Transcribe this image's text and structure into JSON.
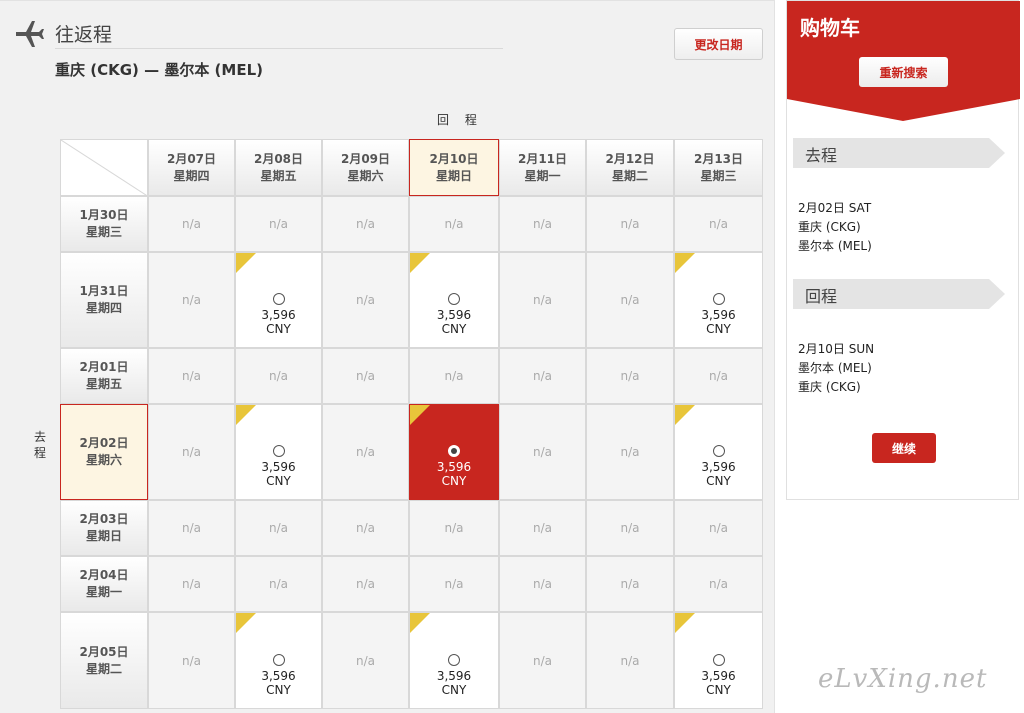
{
  "header": {
    "title": "往返程",
    "route": "重庆 (CKG) — 墨尔本 (MEL)",
    "change_date_label": "更改日期",
    "icon": "plane-icon"
  },
  "grid": {
    "return_label": "回 程",
    "depart_label": "去 程",
    "na": "n/a",
    "return_dates": [
      {
        "date": "2月07日",
        "weekday": "星期四",
        "highlight": false
      },
      {
        "date": "2月08日",
        "weekday": "星期五",
        "highlight": false
      },
      {
        "date": "2月09日",
        "weekday": "星期六",
        "highlight": false
      },
      {
        "date": "2月10日",
        "weekday": "星期日",
        "highlight": true
      },
      {
        "date": "2月11日",
        "weekday": "星期一",
        "highlight": false
      },
      {
        "date": "2月12日",
        "weekday": "星期二",
        "highlight": false
      },
      {
        "date": "2月13日",
        "weekday": "星期三",
        "highlight": false
      }
    ],
    "rows": [
      {
        "date": "1月30日",
        "weekday": "星期三",
        "highlight": false,
        "cells": [
          null,
          null,
          null,
          null,
          null,
          null,
          null
        ]
      },
      {
        "date": "1月31日",
        "weekday": "星期四",
        "highlight": false,
        "cells": [
          null,
          {
            "price": "3,596",
            "currency": "CNY"
          },
          null,
          {
            "price": "3,596",
            "currency": "CNY"
          },
          null,
          null,
          {
            "price": "3,596",
            "currency": "CNY"
          }
        ]
      },
      {
        "date": "2月01日",
        "weekday": "星期五",
        "highlight": false,
        "cells": [
          null,
          null,
          null,
          null,
          null,
          null,
          null
        ]
      },
      {
        "date": "2月02日",
        "weekday": "星期六",
        "highlight": true,
        "cells": [
          null,
          {
            "price": "3,596",
            "currency": "CNY"
          },
          null,
          {
            "price": "3,596",
            "currency": "CNY",
            "selected": true
          },
          null,
          null,
          {
            "price": "3,596",
            "currency": "CNY"
          }
        ]
      },
      {
        "date": "2月03日",
        "weekday": "星期日",
        "highlight": false,
        "cells": [
          null,
          null,
          null,
          null,
          null,
          null,
          null
        ]
      },
      {
        "date": "2月04日",
        "weekday": "星期一",
        "highlight": false,
        "cells": [
          null,
          null,
          null,
          null,
          null,
          null,
          null
        ]
      },
      {
        "date": "2月05日",
        "weekday": "星期二",
        "highlight": false,
        "cells": [
          null,
          {
            "price": "3,596",
            "currency": "CNY"
          },
          null,
          {
            "price": "3,596",
            "currency": "CNY"
          },
          null,
          null,
          {
            "price": "3,596",
            "currency": "CNY"
          }
        ]
      }
    ]
  },
  "cart": {
    "title": "购物车",
    "research_label": "重新搜索",
    "outbound": {
      "heading": "去程",
      "date": "2月02日 SAT",
      "from": "重庆 (CKG)",
      "to": "墨尔本 (MEL)"
    },
    "inbound": {
      "heading": "回程",
      "date": "2月10日 SUN",
      "from": "墨尔本 (MEL)",
      "to": "重庆 (CKG)"
    },
    "continue_label": "继续"
  },
  "colors": {
    "accent": "#c8261f",
    "flag": "#e8c53a",
    "highlight_bg": "#fdf5e2"
  },
  "watermark": "eLvXing.net"
}
